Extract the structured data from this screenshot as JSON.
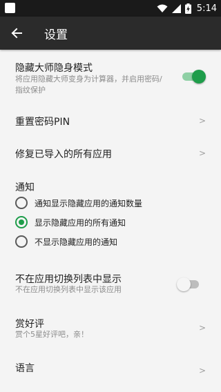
{
  "status_bar": {
    "time": "5:14",
    "icons": [
      "wifi-icon",
      "signal-icon",
      "battery-charging-icon"
    ]
  },
  "app_bar": {
    "title": "设置",
    "back_icon": "arrow-back-icon"
  },
  "settings": {
    "stealth_mode": {
      "title": "隐藏大师隐身模式",
      "subtitle": "将应用隐藏大师变身为计算器，并启用密码/指纹保护",
      "enabled": true
    },
    "reset_pin": {
      "title": "重置密码PIN",
      "chevron": ">"
    },
    "repair_apps": {
      "title": "修复已导入的所有应用",
      "chevron": ">"
    },
    "notifications": {
      "header": "通知",
      "options": [
        {
          "label": "通知显示隐藏应用的通知数量",
          "selected": false
        },
        {
          "label": "显示隐藏应用的所有通知",
          "selected": true
        },
        {
          "label": "不显示隐藏应用的通知",
          "selected": false
        }
      ]
    },
    "hide_in_recents": {
      "title": "不在应用切换列表中显示",
      "subtitle": "不在应用切换列表中显示该应用",
      "enabled": false
    },
    "rate": {
      "title": "赏好评",
      "subtitle": "赏个5星好评吧，亲！",
      "chevron": ">"
    },
    "language": {
      "title": "语言",
      "chevron": ">"
    }
  },
  "colors": {
    "accent": "#1e9d4a",
    "accent_track": "#8fd0a5",
    "app_bar": "#2b2b2b",
    "status_bar": "#1a1a1a",
    "background": "#f4f4f4",
    "off_thumb": "#f5f5f5",
    "off_track": "#bdbdbd"
  }
}
